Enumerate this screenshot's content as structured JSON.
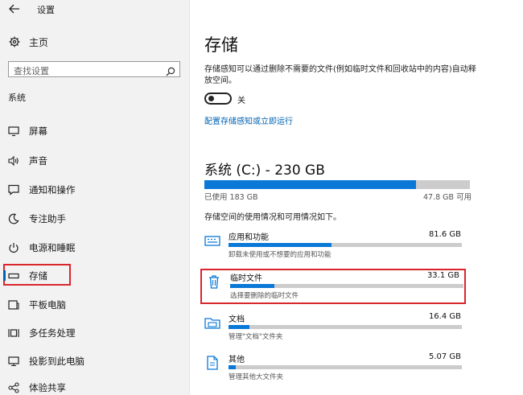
{
  "app_title": "设置",
  "home_label": "主页",
  "search": {
    "placeholder": "查找设置"
  },
  "section_label": "系统",
  "nav": [
    {
      "label": "屏幕"
    },
    {
      "label": "声音"
    },
    {
      "label": "通知和操作"
    },
    {
      "label": "专注助手"
    },
    {
      "label": "电源和睡眠"
    },
    {
      "label": "存储"
    },
    {
      "label": "平板电脑"
    },
    {
      "label": "多任务处理"
    },
    {
      "label": "投影到此电脑"
    },
    {
      "label": "体验共享"
    }
  ],
  "main": {
    "title": "存储",
    "description": "存储感知可以通过删除不需要的文件(例如临时文件和回收站中的内容)自动释放空间。",
    "toggle_label": "关",
    "link": "配置存储感知或立即运行",
    "drive_title": "系统 (C:) - 230 GB",
    "drive_used_fraction": 0.796,
    "used_label": "已使用 183 GB",
    "free_label": "47.8 GB 可用",
    "breakdown_text": "存储空间的使用情况和可用情况如下。",
    "categories": [
      {
        "name": "应用和功能",
        "size": "81.6 GB",
        "desc": "卸载未使用或不想要的应用和功能",
        "fraction": 0.44
      },
      {
        "name": "临时文件",
        "size": "33.1 GB",
        "desc": "选择要删除的临时文件",
        "fraction": 0.19
      },
      {
        "name": "文档",
        "size": "16.4 GB",
        "desc": "管理\"文档\"文件夹",
        "fraction": 0.09
      },
      {
        "name": "其他",
        "size": "5.07 GB",
        "desc": "管理其他大文件夹",
        "fraction": 0.03
      }
    ]
  },
  "colors": {
    "accent": "#0a78d7",
    "highlight_box": "#d9262e",
    "link": "#0063b1"
  }
}
